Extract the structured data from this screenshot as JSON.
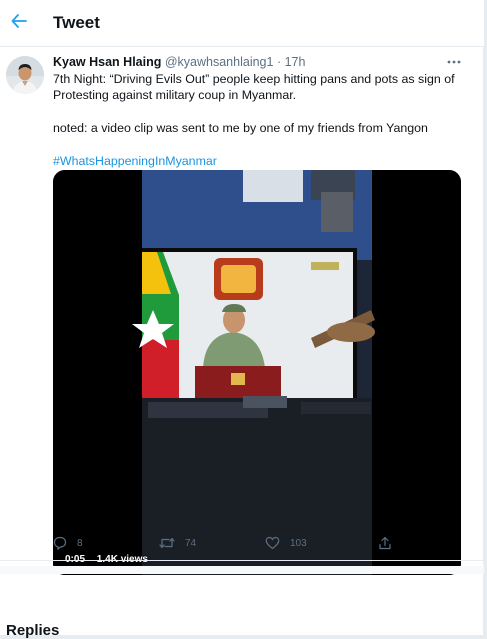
{
  "header": {
    "title": "Tweet",
    "back_icon": "arrow-left-icon",
    "accent": "#1da1f2"
  },
  "tweet": {
    "display_name": "Kyaw Hsan Hlaing",
    "handle": "@kyawhsanhlaing1",
    "separator": "·",
    "time": "17h",
    "text_line1": "7th Night: “Driving Evils Out” people keep hitting pans and pots as sign of Protesting against military coup in Myanmar.",
    "text_line2": "noted: a video clip was sent to me by one of my friends from Yangon",
    "hashtag": "#WhatsHappeningInMyanmar",
    "hashtag_color": "#1b95e0",
    "video": {
      "duration": "0:05",
      "views": "1.4K views"
    },
    "actions": {
      "reply_count": "8",
      "retweet_count": "74",
      "like_count": "103"
    }
  },
  "replies": {
    "heading": "Replies"
  }
}
